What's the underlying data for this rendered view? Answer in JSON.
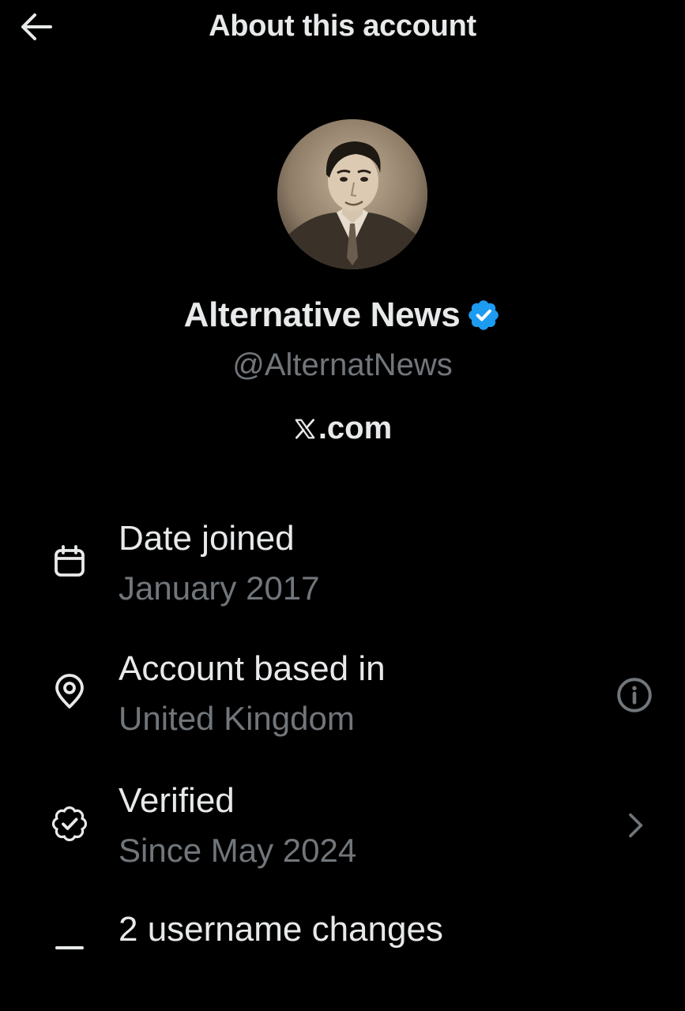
{
  "header": {
    "title": "About this account",
    "back_icon": "arrow-left-icon"
  },
  "profile": {
    "name": "Alternative News",
    "handle": "@AlternatNews",
    "verified_badge_color": "#1d9bf0",
    "site": ".com",
    "site_logo_icon": "x-logo-icon"
  },
  "rows": [
    {
      "icon": "calendar-icon",
      "label": "Date joined",
      "value": "January 2017"
    },
    {
      "icon": "location-pin-icon",
      "label": "Account based in",
      "value": "United Kingdom",
      "right_icon": "info-icon"
    },
    {
      "icon": "verified-outline-icon",
      "label": "Verified",
      "value": "Since May 2024",
      "right_icon": "chevron-right-icon"
    },
    {
      "icon": "username-icon",
      "label": "2 username changes",
      "value": ""
    }
  ],
  "colors": {
    "background": "#000000",
    "primary_text": "#e7e9ea",
    "secondary_text": "#71767b",
    "accent": "#1d9bf0"
  }
}
